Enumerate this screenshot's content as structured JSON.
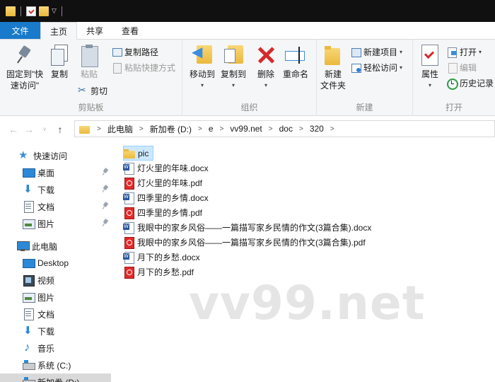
{
  "ribbon_tabs": [
    "文件",
    "主页",
    "共享",
    "查看"
  ],
  "clipboard_group": {
    "label": "剪贴板",
    "pin_label": "固定到\"快\n速访问\"",
    "copy_label": "复制",
    "paste_label": "粘贴",
    "copy_path_label": "复制路径",
    "paste_shortcut_label": "粘贴快捷方式",
    "cut_label": "剪切"
  },
  "organize_group": {
    "label": "组织",
    "move_to_label": "移动到",
    "copy_to_label": "复制到",
    "delete_label": "删除",
    "rename_label": "重命名"
  },
  "new_group": {
    "label": "新建",
    "new_folder_label": "新建\n文件夹",
    "new_item_label": "新建项目",
    "easy_access_label": "轻松访问"
  },
  "open_group": {
    "label": "打开",
    "properties_label": "属性",
    "open_label": "打开",
    "edit_label": "编辑",
    "history_label": "历史记录"
  },
  "breadcrumb": [
    "此电脑",
    "新加卷 (D:)",
    "e",
    "vv99.net",
    "doc",
    "320"
  ],
  "sidebar": {
    "quick_access": "快速访问",
    "quick_items": [
      "桌面",
      "下载",
      "文档",
      "图片"
    ],
    "this_pc": "此电脑",
    "pc_items": [
      "Desktop",
      "视频",
      "图片",
      "文档",
      "下载",
      "音乐",
      "系统 (C:)",
      "新加卷 (D:)"
    ]
  },
  "files": [
    {
      "name": "pic",
      "type": "folder"
    },
    {
      "name": "灯火里的年味.docx",
      "type": "docx"
    },
    {
      "name": "灯火里的年味.pdf",
      "type": "pdf"
    },
    {
      "name": "四季里的乡情.docx",
      "type": "docx"
    },
    {
      "name": "四季里的乡情.pdf",
      "type": "pdf"
    },
    {
      "name": "我眼中的家乡风俗——一篇描写家乡民情的作文(3篇合集).docx",
      "type": "docx"
    },
    {
      "name": "我眼中的家乡风俗——一篇描写家乡民情的作文(3篇合集).pdf",
      "type": "pdf"
    },
    {
      "name": "月下的乡愁.docx",
      "type": "docx"
    },
    {
      "name": "月下的乡愁.pdf",
      "type": "pdf"
    }
  ],
  "watermark": "vv99.net"
}
